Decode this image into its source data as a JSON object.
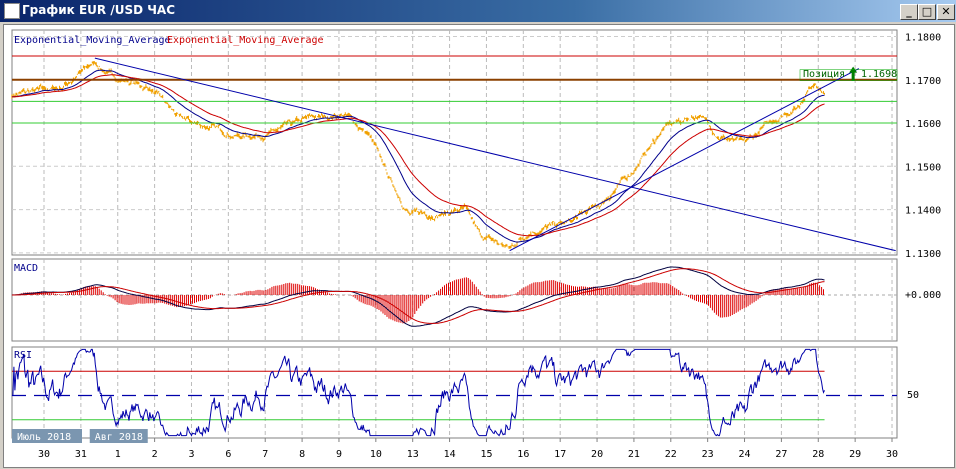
{
  "window": {
    "title": "График EUR /USD  ЧАС",
    "minimize": "_",
    "maximize": "□",
    "close": "✕"
  },
  "legend": {
    "ema1": "Exponential_Moving_Average",
    "ema2": "Exponential_Moving_Average"
  },
  "position_label": {
    "text": "Позиция",
    "price": "1.1698"
  },
  "panels": {
    "macd": "MACD",
    "rsi": "RSI"
  },
  "colors": {
    "price": "#f0a000",
    "ema_fast": "#00008b",
    "ema_slow": "#cc0000",
    "hline_red": "#cc0000",
    "hline_brown": "#8b4000",
    "hline_green": "#33cc33",
    "trend": "#0000aa"
  },
  "chart_data": [
    {
      "type": "line",
      "title": "EUR/USD H1",
      "ylim": [
        1.1295,
        1.1815
      ],
      "y_ticks": [
        "1.1800",
        "1.1700",
        "1.1600",
        "1.1500",
        "1.1400",
        "1.1300"
      ],
      "y_tick_values": [
        1.18,
        1.17,
        1.16,
        1.15,
        1.14,
        1.13
      ],
      "x_ticks": [
        "30",
        "31",
        "1",
        "2",
        "3",
        "6",
        "7",
        "8",
        "9",
        "10",
        "13",
        "14",
        "15",
        "16",
        "17",
        "20",
        "21",
        "22",
        "23",
        "24",
        "27",
        "28",
        "29",
        "30"
      ],
      "month_labels": [
        {
          "text": "Июль 2018",
          "at": 0
        },
        {
          "text": "Авг 2018",
          "at": 2
        }
      ],
      "price_keypoints": [
        [
          -0.87,
          1.1665
        ],
        [
          0.43,
          1.168
        ],
        [
          1.38,
          1.174
        ],
        [
          1.79,
          1.171
        ],
        [
          2.87,
          1.168
        ],
        [
          3.69,
          1.161
        ],
        [
          5.31,
          1.157
        ],
        [
          6.12,
          1.1575
        ],
        [
          7.21,
          1.161
        ],
        [
          8.16,
          1.162
        ],
        [
          8.83,
          1.157
        ],
        [
          9.38,
          1.147
        ],
        [
          9.92,
          1.139
        ],
        [
          10.73,
          1.139
        ],
        [
          11.41,
          1.14
        ],
        [
          11.82,
          1.134
        ],
        [
          12.63,
          1.131
        ],
        [
          13.17,
          1.135
        ],
        [
          14.25,
          1.137
        ],
        [
          15.07,
          1.141
        ],
        [
          15.88,
          1.148
        ],
        [
          16.83,
          1.159
        ],
        [
          17.78,
          1.162
        ],
        [
          18.32,
          1.157
        ],
        [
          19.0,
          1.155
        ],
        [
          19.81,
          1.161
        ],
        [
          20.49,
          1.164
        ],
        [
          20.76,
          1.169
        ],
        [
          21.17,
          1.168
        ]
      ],
      "horizontal_lines": [
        {
          "price": 1.1755,
          "color": "hline_red"
        },
        {
          "price": 1.17,
          "color": "hline_brown"
        },
        {
          "price": 1.165,
          "color": "hline_green"
        },
        {
          "price": 1.16,
          "color": "hline_green"
        }
      ],
      "trendlines": [
        [
          [
            1.38,
            1.175
          ],
          [
            23.1,
            1.1305
          ]
        ],
        [
          [
            12.63,
            1.1305
          ],
          [
            22.1,
            1.1726
          ]
        ]
      ],
      "position": {
        "x": 22.0,
        "price": 1.1698
      }
    },
    {
      "type": "line",
      "title": "MACD",
      "y_ticks": [
        "+0.000"
      ]
    },
    {
      "type": "line",
      "title": "RSI",
      "y_ticks": [
        "50"
      ],
      "levels": [
        70,
        50,
        30
      ],
      "ylim": [
        15,
        90
      ]
    }
  ]
}
